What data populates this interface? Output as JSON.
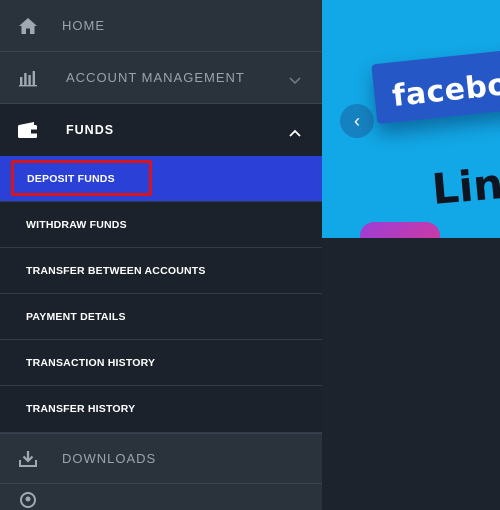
{
  "sidebar": {
    "items": [
      {
        "label": "HOME",
        "icon": "home-icon"
      },
      {
        "label": "ACCOUNT MANAGEMENT",
        "icon": "bar-chart-icon"
      },
      {
        "label": "FUNDS",
        "icon": "wallet-icon"
      }
    ],
    "funds_submenu": [
      {
        "label": "DEPOSIT FUNDS",
        "active": true
      },
      {
        "label": "WITHDRAW FUNDS"
      },
      {
        "label": "TRANSFER BETWEEN ACCOUNTS"
      },
      {
        "label": "PAYMENT DETAILS"
      },
      {
        "label": "TRANSACTION HISTORY"
      },
      {
        "label": "TRANSFER HISTORY"
      }
    ],
    "downloads": {
      "label": "DOWNLOADS",
      "icon": "download-icon"
    }
  },
  "banner": {
    "facebook_text": "faceboo",
    "linkedin_text": "Lin"
  },
  "colors": {
    "sidebar_bg": "#2a323c",
    "submenu_bg": "#1b222b",
    "active_bg": "#2a40d6",
    "highlight_border": "#d8141d",
    "banner_bg": "#12a7e6"
  }
}
